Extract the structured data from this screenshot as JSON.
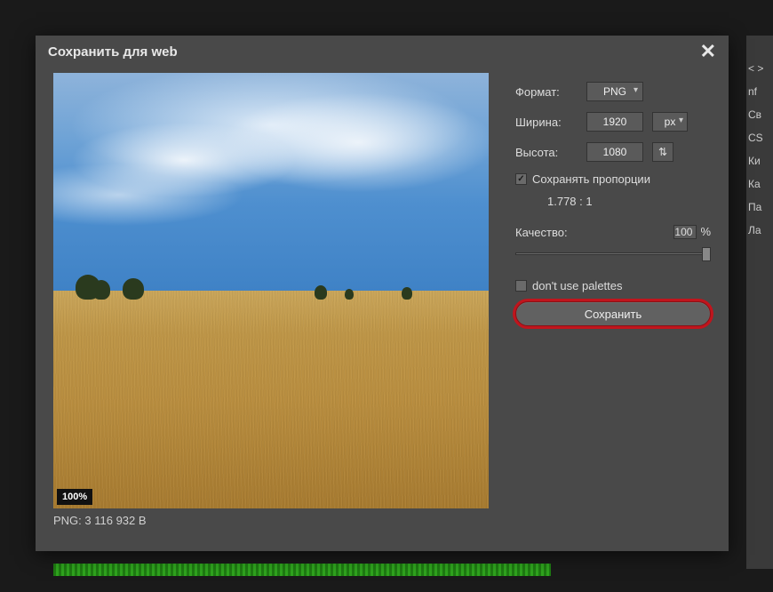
{
  "dialog": {
    "title": "Сохранить для web",
    "close_tooltip": "Close"
  },
  "preview": {
    "zoom_label": "100%",
    "file_info": "PNG: 3 116 932 B"
  },
  "controls": {
    "format_label": "Формат:",
    "format_value": "PNG",
    "width_label": "Ширина:",
    "width_value": "1920",
    "width_unit": "px",
    "height_label": "Высота:",
    "height_value": "1080",
    "keep_ratio_label": "Сохранять пропорции",
    "keep_ratio_checked": true,
    "ratio_text": "1.778 : 1",
    "quality_label": "Качество:",
    "quality_value": "100",
    "quality_pct": "%",
    "palettes_label": "don't use palettes",
    "palettes_checked": false,
    "save_button": "Сохранить"
  },
  "bg_sidebar": [
    "< >",
    "nf",
    "Св",
    "CS",
    "Ки",
    "Ка",
    "Па",
    "Ла"
  ]
}
